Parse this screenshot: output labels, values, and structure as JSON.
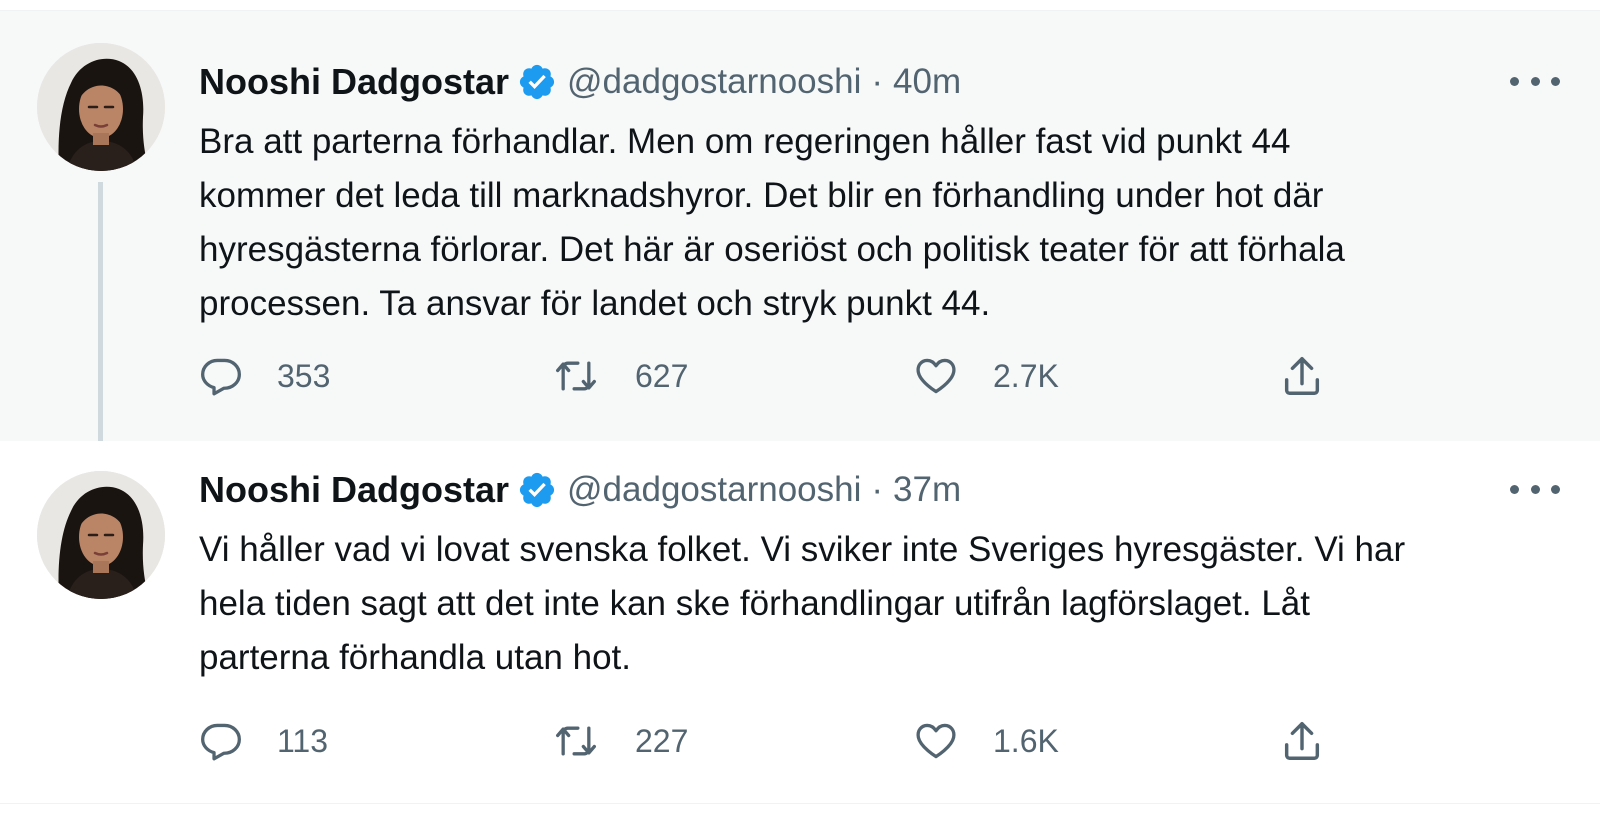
{
  "tweets": [
    {
      "author_name": "Nooshi Dadgostar",
      "handle": "@dadgostarnooshi",
      "separator": "·",
      "time": "40m",
      "text": "Bra att parterna förhandlar. Men om regeringen håller fast vid punkt 44\nkommer det leda till marknadshyror. Det blir en förhandling under hot där\nhyresgästerna förlorar. Det här är oseriöst och politisk teater för att förhala\nprocessen. Ta ansvar för landet och stryk punkt 44.",
      "replies": "353",
      "retweets": "627",
      "likes": "2.7K"
    },
    {
      "author_name": "Nooshi Dadgostar",
      "handle": "@dadgostarnooshi",
      "separator": "·",
      "time": "37m",
      "text": "Vi håller vad vi lovat svenska folket. Vi sviker inte Sveriges hyresgäster. Vi har\nhela tiden sagt att det inte kan ske förhandlingar utifrån lagförslaget. Låt\nparterna förhandla utan hot.",
      "replies": "113",
      "retweets": "227",
      "likes": "1.6K"
    }
  ],
  "icons": {
    "verified": "verified-badge-icon",
    "more": "more-options-icon",
    "reply": "reply-icon",
    "retweet": "retweet-icon",
    "like": "like-icon",
    "share": "share-icon"
  },
  "colors": {
    "verified_blue": "#1d9bf0",
    "muted_text": "#536471",
    "thread_line": "#cfd9de",
    "highlight_bg": "#f7f9f9"
  }
}
